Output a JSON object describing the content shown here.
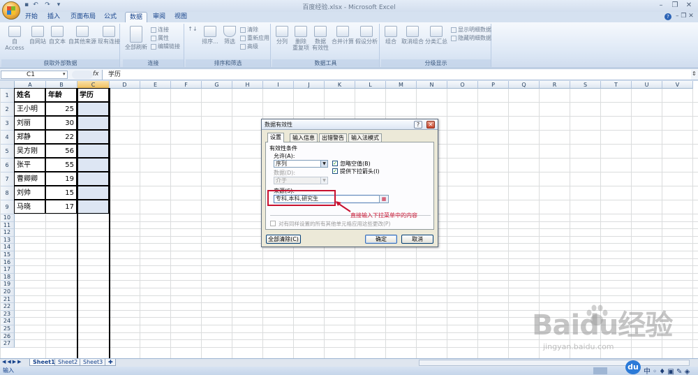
{
  "window": {
    "title": "百度经验.xlsx - Microsoft Excel"
  },
  "tabs": [
    {
      "label": "开始",
      "active": false
    },
    {
      "label": "插入",
      "active": false
    },
    {
      "label": "页面布局",
      "active": false
    },
    {
      "label": "公式",
      "active": false
    },
    {
      "label": "数据",
      "active": true
    },
    {
      "label": "审阅",
      "active": false
    },
    {
      "label": "视图",
      "active": false
    }
  ],
  "ribbon": {
    "get_external": {
      "label": "获取外部数据",
      "buttons": [
        "自 Access",
        "自网站",
        "自文本",
        "自其他来源",
        "现有连接"
      ]
    },
    "connections": {
      "label": "连接",
      "refresh_all": "全部刷新",
      "small": [
        "连接",
        "属性",
        "编辑链接"
      ]
    },
    "sort_filter": {
      "label": "排序和筛选",
      "sort": "排序...",
      "filter": "筛选",
      "small": [
        "清除",
        "重新应用",
        "高级"
      ]
    },
    "data_tools": {
      "label": "数据工具",
      "buttons": [
        "分列",
        "删除\n重复项",
        "数据\n有效性",
        "合并计算",
        "假设分析"
      ]
    },
    "outline": {
      "label": "分级显示",
      "buttons": [
        "组合",
        "取消组合",
        "分类汇总"
      ],
      "small": [
        "显示明细数据",
        "隐藏明细数据"
      ]
    }
  },
  "formula_bar": {
    "name_box": "C1",
    "fx": "fx",
    "formula": "学历"
  },
  "columns": [
    "A",
    "B",
    "C",
    "D",
    "E",
    "F",
    "G",
    "H",
    "I",
    "J",
    "K",
    "L",
    "M",
    "N",
    "O",
    "P",
    "Q",
    "R",
    "S",
    "T",
    "U",
    "V"
  ],
  "table": {
    "headers": [
      "姓名",
      "年龄",
      "学历"
    ],
    "rows": [
      [
        "王小明",
        "25"
      ],
      [
        "刘丽",
        "30"
      ],
      [
        "郑静",
        "22"
      ],
      [
        "吴方刚",
        "56"
      ],
      [
        "张平",
        "55"
      ],
      [
        "曹卿卿",
        "19"
      ],
      [
        "刘帅",
        "15"
      ],
      [
        "马晓",
        "17"
      ]
    ]
  },
  "row_numbers": [
    "1",
    "2",
    "3",
    "4",
    "5",
    "6",
    "7",
    "8",
    "9",
    "10",
    "11",
    "12",
    "13",
    "14",
    "15",
    "16",
    "17",
    "18",
    "19",
    "20",
    "21",
    "22",
    "23",
    "24",
    "25",
    "26",
    "27"
  ],
  "sheet_tabs": [
    "Sheet1",
    "Sheet2",
    "Sheet3"
  ],
  "status": {
    "mode": "输入"
  },
  "dialog": {
    "title": "数据有效性",
    "tabs": [
      "设置",
      "输入信息",
      "出错警告",
      "输入法模式"
    ],
    "criteria_label": "有效性条件",
    "allow_label": "允许(A):",
    "allow_value": "序列",
    "data_label": "数据(D):",
    "data_value": "介于",
    "ignore_blank": "忽略空值(B)",
    "dropdown": "提供下拉箭头(I)",
    "source_label": "来源(S):",
    "source_value": "专科,本科,研究生",
    "apply_all": "对有同样设置的所有其他单元格应用这些更改(P)",
    "clear_all": "全部清除(C)",
    "ok": "确定",
    "cancel": "取消",
    "help_icon": "?"
  },
  "annotation": "直接输入下拉菜单中的内容",
  "watermark": {
    "text": "Baidu经验",
    "url": "jingyan.baidu.com"
  },
  "colors": {
    "accent": "#c8102e",
    "ribbon": "#dce7f5",
    "selected": "#f1c15f"
  }
}
